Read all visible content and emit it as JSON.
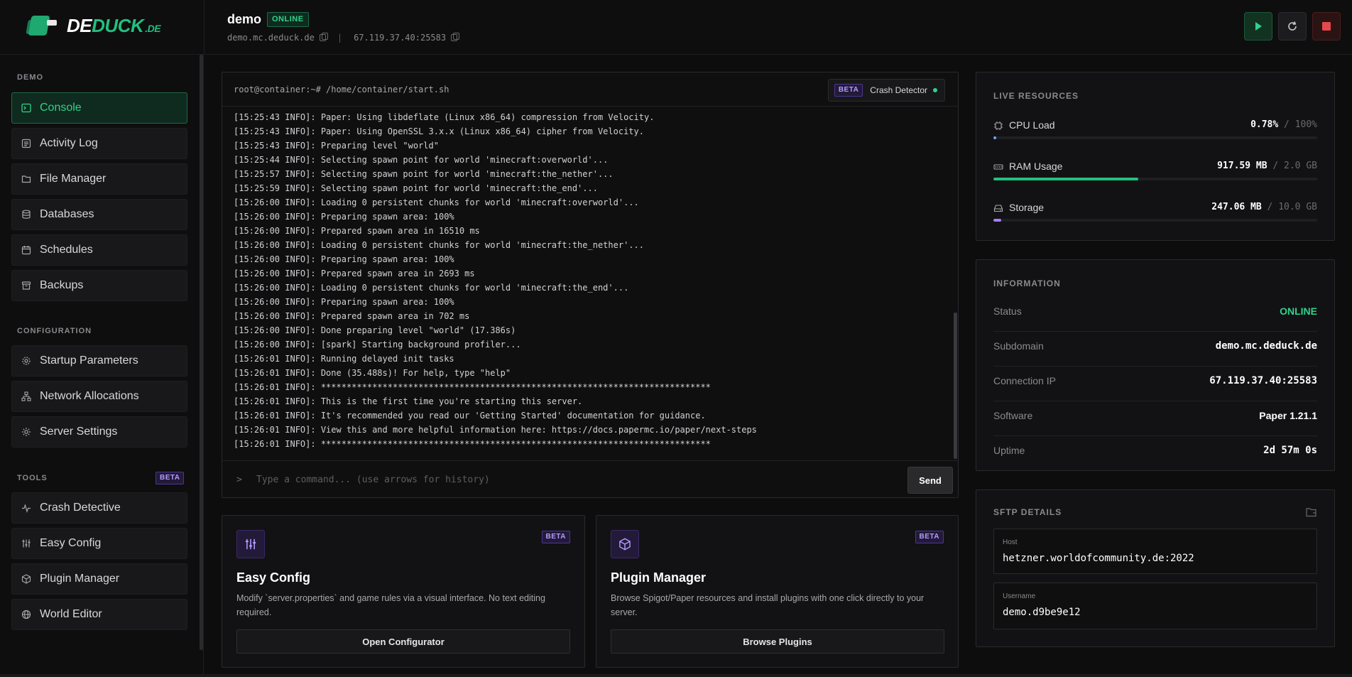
{
  "brand": {
    "name_white": "DE",
    "name_green": "DUCK",
    "tld": ".DE"
  },
  "server": {
    "name": "demo",
    "status": "ONLINE",
    "host": "demo.mc.deduck.de",
    "separator": "|",
    "ip": "67.119.37.40:25583"
  },
  "controls": {
    "start": "play-icon",
    "restart": "refresh-icon",
    "stop": "stop-icon"
  },
  "sidebar": {
    "sections": [
      {
        "title": "DEMO"
      },
      {
        "title": "CONFIGURATION"
      },
      {
        "title": "TOOLS",
        "badge": "BETA"
      }
    ],
    "items": [
      {
        "label": "Console",
        "icon": "terminal-icon"
      },
      {
        "label": "Activity Log",
        "icon": "list-icon"
      },
      {
        "label": "File Manager",
        "icon": "folder-icon"
      },
      {
        "label": "Databases",
        "icon": "database-icon"
      },
      {
        "label": "Schedules",
        "icon": "calendar-icon"
      },
      {
        "label": "Backups",
        "icon": "archive-icon"
      },
      {
        "label": "Startup Parameters",
        "icon": "gear-icon"
      },
      {
        "label": "Network Allocations",
        "icon": "network-icon"
      },
      {
        "label": "Server Settings",
        "icon": "settings-icon"
      },
      {
        "label": "Crash Detective",
        "icon": "pulse-icon"
      },
      {
        "label": "Easy Config",
        "icon": "sliders-icon"
      },
      {
        "label": "Plugin Manager",
        "icon": "package-icon"
      },
      {
        "label": "World Editor",
        "icon": "globe-icon"
      }
    ]
  },
  "console": {
    "path": "root@container:~# /home/container/start.sh",
    "crash_detector": {
      "badge": "BETA",
      "label": "Crash Detector"
    },
    "lines": [
      "[15:25:43 INFO]: Paper: Using libdeflate (Linux x86_64) compression from Velocity.",
      "[15:25:43 INFO]: Paper: Using OpenSSL 3.x.x (Linux x86_64) cipher from Velocity.",
      "[15:25:43 INFO]: Preparing level \"world\"",
      "[15:25:44 INFO]: Selecting spawn point for world 'minecraft:overworld'...",
      "[15:25:57 INFO]: Selecting spawn point for world 'minecraft:the_nether'...",
      "[15:25:59 INFO]: Selecting spawn point for world 'minecraft:the_end'...",
      "[15:26:00 INFO]: Loading 0 persistent chunks for world 'minecraft:overworld'...",
      "[15:26:00 INFO]: Preparing spawn area: 100%",
      "[15:26:00 INFO]: Prepared spawn area in 16510 ms",
      "[15:26:00 INFO]: Loading 0 persistent chunks for world 'minecraft:the_nether'...",
      "[15:26:00 INFO]: Preparing spawn area: 100%",
      "[15:26:00 INFO]: Prepared spawn area in 2693 ms",
      "[15:26:00 INFO]: Loading 0 persistent chunks for world 'minecraft:the_end'...",
      "[15:26:00 INFO]: Preparing spawn area: 100%",
      "[15:26:00 INFO]: Prepared spawn area in 702 ms",
      "[15:26:00 INFO]: Done preparing level \"world\" (17.386s)",
      "[15:26:00 INFO]: [spark] Starting background profiler...",
      "[15:26:01 INFO]: Running delayed init tasks",
      "[15:26:01 INFO]: Done (35.488s)! For help, type \"help\"",
      "[15:26:01 INFO]: ****************************************************************************",
      "[15:26:01 INFO]: This is the first time you're starting this server.",
      "[15:26:01 INFO]: It's recommended you read our 'Getting Started' documentation for guidance.",
      "[15:26:01 INFO]: View this and more helpful information here: https://docs.papermc.io/paper/next-steps",
      "[15:26:01 INFO]: ****************************************************************************"
    ],
    "prompt": ">",
    "placeholder": "Type a command... (use arrows for history)",
    "send_label": "Send"
  },
  "cards": [
    {
      "badge": "BETA",
      "title": "Easy Config",
      "description": "Modify `server.properties` and game rules via a visual interface. No text editing required.",
      "button": "Open Configurator",
      "icon": "sliders-icon"
    },
    {
      "badge": "BETA",
      "title": "Plugin Manager",
      "description": "Browse Spigot/Paper resources and install plugins with one click directly to your server.",
      "button": "Browse Plugins",
      "icon": "package-icon"
    }
  ],
  "resources": {
    "title": "LIVE RESOURCES",
    "items": [
      {
        "name": "CPU Load",
        "used": "0.78%",
        "sep": "/",
        "total": "100%",
        "fraction": 0.0078,
        "color": "#6ea8ff"
      },
      {
        "name": "RAM Usage",
        "used": "917.59 MB",
        "sep": "/",
        "total": "2.0 GB",
        "fraction": 0.448,
        "color": "#22c07e"
      },
      {
        "name": "Storage",
        "used": "247.06 MB",
        "sep": "/",
        "total": "10.0 GB",
        "fraction": 0.024,
        "color": "#a87bff"
      }
    ]
  },
  "information": {
    "title": "INFORMATION",
    "rows": [
      {
        "key": "Status",
        "value": "ONLINE"
      },
      {
        "key": "Subdomain",
        "value": "demo.mc.deduck.de"
      },
      {
        "key": "Connection IP",
        "value": "67.119.37.40:25583"
      },
      {
        "key": "Software",
        "value": "Paper 1.21.1"
      },
      {
        "key": "Uptime",
        "value": "2d 57m 0s"
      }
    ]
  },
  "sftp": {
    "title": "SFTP DETAILS",
    "host_label": "Host",
    "host": "hetzner.worldofcommunity.de:2022",
    "username_label": "Username",
    "username": "demo.d9be9e12"
  }
}
